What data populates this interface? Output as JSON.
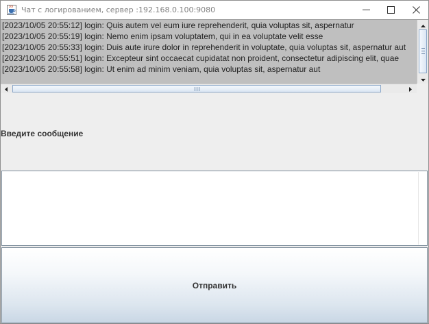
{
  "window": {
    "title": "Чат с логированием, сервер :192.168.0.100:9080"
  },
  "icons": {
    "app": "java-cup-icon",
    "minimize": "minimize-icon",
    "maximize": "maximize-icon",
    "close": "close-icon",
    "scroll_up": "arrow-up-icon",
    "scroll_down": "arrow-down-icon",
    "scroll_left": "arrow-left-icon",
    "scroll_right": "arrow-right-icon"
  },
  "log": {
    "lines": [
      "[2023/10/05 20:55:12] login: Quis autem vel eum iure reprehenderit, quia voluptas sit, aspernatur",
      "[2023/10/05 20:55:19] login: Nemo enim ipsam voluptatem, qui in ea voluptate velit esse",
      "[2023/10/05 20:55:33] login: Duis aute irure dolor in reprehenderit in voluptate, quia voluptas sit, aspernatur aut",
      "[2023/10/05 20:55:51] login: Excepteur sint occaecat cupidatat non proident, consectetur adipiscing elit, quae",
      "[2023/10/05 20:55:58] login: Ut enim ad minim veniam, quia voluptas sit, aspernatur aut"
    ]
  },
  "prompt": {
    "label": "Введите сообщение"
  },
  "message_input": {
    "value": "",
    "placeholder": ""
  },
  "send": {
    "label": "Отправить"
  },
  "colors": {
    "log_background": "#bfbfbf",
    "window_background": "#eeeeee",
    "scroll_thumb_border": "#8ba7c8",
    "button_gradient_bottom": "#c9d7e5"
  }
}
